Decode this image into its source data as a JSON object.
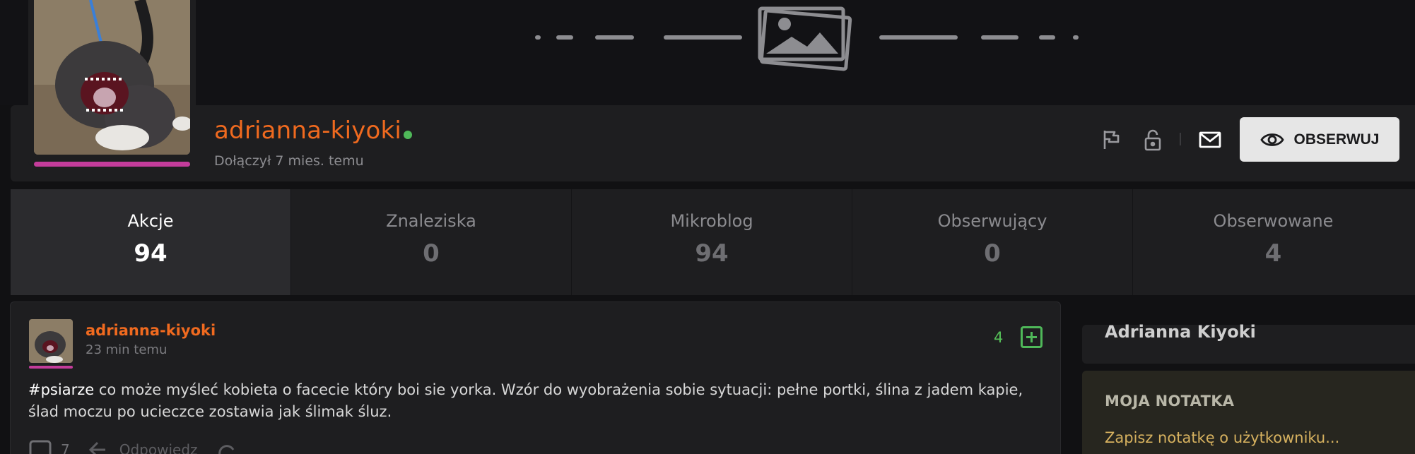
{
  "banner": {
    "icon": "image-placeholder-icon"
  },
  "profile": {
    "username": "adrianna-kiyoki",
    "joined": "Dołączył 7 mies. temu",
    "online": true,
    "accent_color": "#f06a1f",
    "online_color": "#4fb859",
    "avatar_bar_color": "#c43c9b",
    "actions": {
      "report_icon": "flag-icon",
      "block_icon": "lock-icon",
      "message_icon": "mail-icon",
      "observe_label": "OBSERWUJ",
      "observe_icon": "eye-icon"
    }
  },
  "stats": [
    {
      "label": "Akcje",
      "value": "94",
      "active": true
    },
    {
      "label": "Znaleziska",
      "value": "0",
      "active": false
    },
    {
      "label": "Mikroblog",
      "value": "94",
      "active": false
    },
    {
      "label": "Obserwujący",
      "value": "0",
      "active": false
    },
    {
      "label": "Obserwowane",
      "value": "4",
      "active": false
    }
  ],
  "post": {
    "author": "adrianna-kiyoki",
    "time": "23 min temu",
    "votes": "4",
    "tag": "#psiarze",
    "text": " co może myśleć kobieta o facecie który boi sie yorka. Wzór do wyobrażenia sobie sytuacji: pełne portki, ślina z jadem kapie, ślad moczu po ucieczce zostawia jak ślimak śluz.",
    "comments": "7",
    "reply_label": "Odpowiedz"
  },
  "sidebar": {
    "name": "Adrianna Kiyoki",
    "note_title": "MOJA NOTATKA",
    "note_placeholder": "Zapisz notatkę o użytkowniku..."
  }
}
